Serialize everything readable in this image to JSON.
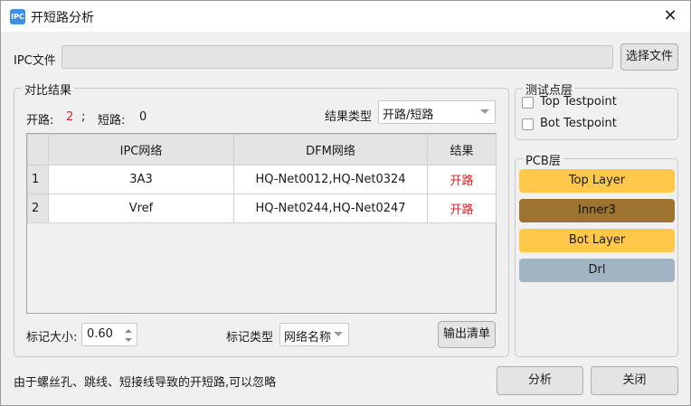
{
  "window": {
    "title": "开短路分析",
    "app_icon_text": "IPC"
  },
  "ipc_file": {
    "label": "IPC文件",
    "value": "",
    "browse_label": "选择文件"
  },
  "compare": {
    "group_title": "对比结果",
    "open_label": "开路:",
    "open_count": "2",
    "separator": ";",
    "short_label": "短路:",
    "short_count": "0",
    "result_type_label": "结果类型",
    "result_type_value": "开路/短路"
  },
  "table": {
    "headers": [
      "IPC网络",
      "DFM网络",
      "结果"
    ],
    "rows": [
      {
        "num": "1",
        "ipc": "3A3",
        "dfm": "HQ-Net0012,HQ-Net0324",
        "result": "开路"
      },
      {
        "num": "2",
        "ipc": "Vref",
        "dfm": "HQ-Net0244,HQ-Net0247",
        "result": "开路"
      }
    ]
  },
  "marker": {
    "size_label": "标记大小:",
    "size_value": "0.60",
    "type_label": "标记类型",
    "type_value": "网络名称",
    "export_label": "输出清单"
  },
  "testpoint_layers": {
    "title": "测试点层",
    "items": [
      {
        "label": "Top Testpoint",
        "checked": false
      },
      {
        "label": "Bot Testpoint",
        "checked": false
      }
    ]
  },
  "pcb_layers": {
    "title": "PCB层",
    "items": [
      {
        "label": "Top Layer",
        "color": "#ffc84a"
      },
      {
        "label": "Inner3",
        "color": "#9c7430"
      },
      {
        "label": "Bot Layer",
        "color": "#ffc84a"
      },
      {
        "label": "Drl",
        "color": "#a0b4c4"
      }
    ]
  },
  "footer": {
    "note": "由于螺丝孔、跳线、短接线导致的开短路,可以忽略",
    "analyze_label": "分析",
    "close_label": "关闭"
  }
}
